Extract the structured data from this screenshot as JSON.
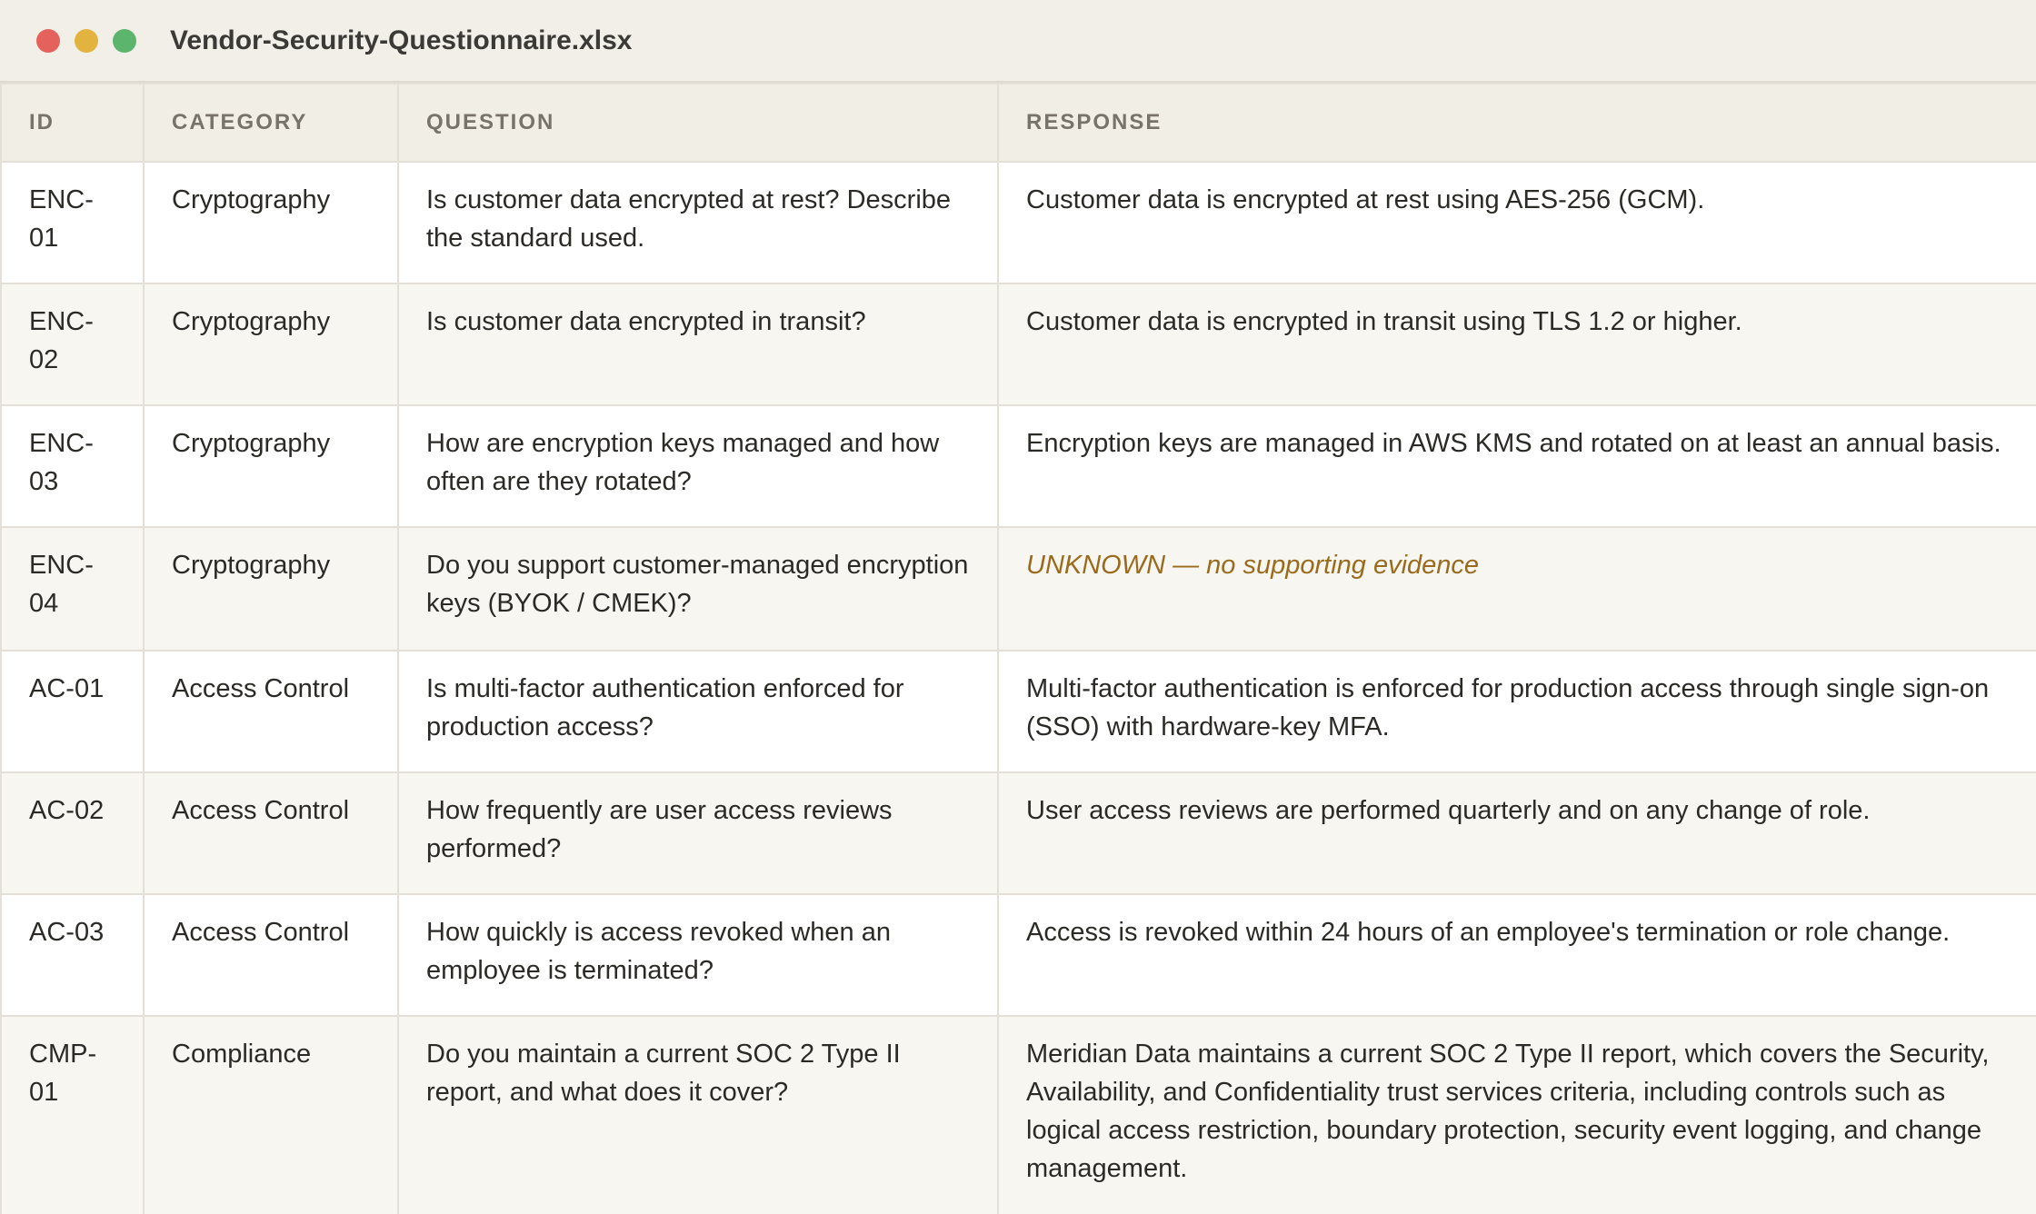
{
  "window": {
    "title": "Vendor-Security-Questionnaire.xlsx"
  },
  "table": {
    "columns": [
      "ID",
      "CATEGORY",
      "QUESTION",
      "RESPONSE"
    ],
    "rows": [
      {
        "id": "ENC-01",
        "category": "Cryptography",
        "question": "Is customer data encrypted at rest? Describe the standard used.",
        "response": "Customer data is encrypted at rest using AES-256 (GCM)."
      },
      {
        "id": "ENC-02",
        "category": "Cryptography",
        "question": "Is customer data encrypted in transit?",
        "response": "Customer data is encrypted in transit using TLS 1.2 or higher."
      },
      {
        "id": "ENC-03",
        "category": "Cryptography",
        "question": "How are encryption keys managed and how often are they rotated?",
        "response": "Encryption keys are managed in AWS KMS and rotated on at least an annual basis."
      },
      {
        "id": "ENC-04",
        "category": "Cryptography",
        "question": "Do you support customer-managed encryption keys (BYOK / CMEK)?",
        "response": "UNKNOWN — no supporting evidence"
      },
      {
        "id": "AC-01",
        "category": "Access Control",
        "question": "Is multi-factor authentication enforced for production access?",
        "response": "Multi-factor authentication is enforced for production access through single sign-on (SSO) with hardware-key MFA."
      },
      {
        "id": "AC-02",
        "category": "Access Control",
        "question": "How frequently are user access reviews performed?",
        "response": "User access reviews are performed quarterly and on any change of role."
      },
      {
        "id": "AC-03",
        "category": "Access Control",
        "question": "How quickly is access revoked when an employee is terminated?",
        "response": "Access is revoked within 24 hours of an employee's termination or role change."
      },
      {
        "id": "CMP-01",
        "category": "Compliance",
        "question": "Do you maintain a current SOC 2 Type II report, and what does it cover?",
        "response": "Meridian Data maintains a current SOC 2 Type II report, which covers the Security, Availability, and Confidentiality trust services criteria, including controls such as logical access restriction, boundary protection, security event logging, and change management."
      }
    ]
  },
  "colors": {
    "unknown_response": "#9a6b1c",
    "close_button": "#e5625c",
    "minimize_button": "#e3b340",
    "zoom_button": "#5bb56c"
  }
}
